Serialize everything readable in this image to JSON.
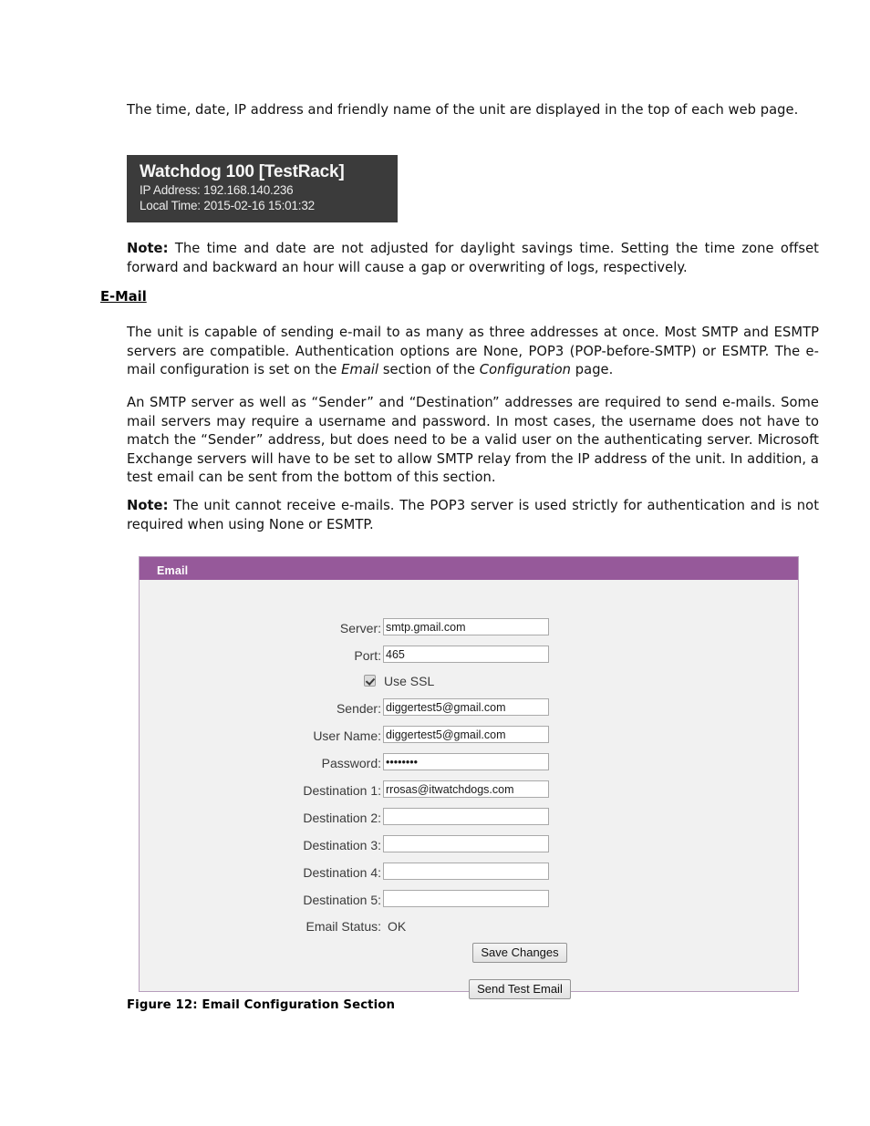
{
  "document": {
    "intro_paragraph": "The time, date, IP address and friendly name of the unit are displayed in the top of each web page.",
    "note_time": {
      "label": "Note:",
      "text": " The time and date are not adjusted for daylight savings time.  Setting the time zone offset forward and backward an hour will cause a gap or overwriting of logs, respectively."
    },
    "section_heading": "E-Mail",
    "paragraph_capability_part1": "The unit is capable of sending e-mail to as many as three addresses at once.  Most SMTP and ESMTP servers are compatible.  Authentication options are None, POP3 (POP-before-SMTP) or ESMTP. The e-mail configuration is set on the ",
    "paragraph_capability_em1": "Email",
    "paragraph_capability_part2": " section of the ",
    "paragraph_capability_em2": "Configuration",
    "paragraph_capability_part3": " page.",
    "paragraph_requirements": "An SMTP server as well as “Sender” and “Destination” addresses are required to send e-mails.  Some mail servers may require a username and password.  In most cases, the username does not have to match the “Sender” address, but does need to be a valid user on the authenticating server.  Microsoft Exchange servers will have to be set to allow SMTP relay from the IP address of the unit. In addition, a test email can be sent from the bottom of this section.",
    "note_receive": {
      "label": "Note:",
      "text": " The unit cannot receive e-mails.  The POP3 server is used strictly for authentication and is not required when using None or ESMTP."
    },
    "figure_caption": "Figure 12: Email Configuration Section"
  },
  "device_banner": {
    "title": "Watchdog 100 [TestRack]",
    "ip_line": "IP Address: 192.168.140.236",
    "time_line": "Local Time: 2015-02-16 15:01:32",
    "background_color": "#3b3b3b",
    "text_color": "#f2f2f2"
  },
  "email_panel": {
    "header_title": "Email",
    "header_color": "#96599a",
    "body_color": "#f1f1f1",
    "border_color": "#b79ebc",
    "fields": [
      {
        "label": "Server:",
        "value": "smtp.gmail.com",
        "placeholder": ""
      },
      {
        "label": "Port:",
        "value": "465",
        "placeholder": ""
      },
      {
        "label": "Sender:",
        "value": "diggertest5@gmail.com",
        "placeholder": ""
      },
      {
        "label": "User Name:",
        "value": "diggertest5@gmail.com",
        "placeholder": ""
      },
      {
        "label": "Password:",
        "value": "••••••••",
        "placeholder": ""
      },
      {
        "label": "Destination 1:",
        "value": "rrosas@itwatchdogs.com",
        "placeholder": ""
      },
      {
        "label": "Destination 2:",
        "value": "",
        "placeholder": ""
      },
      {
        "label": "Destination 3:",
        "value": "",
        "placeholder": ""
      },
      {
        "label": "Destination 4:",
        "value": "",
        "placeholder": ""
      },
      {
        "label": "Destination 5:",
        "value": "",
        "placeholder": ""
      }
    ],
    "use_ssl": {
      "label": "Use SSL",
      "checked": true
    },
    "status": {
      "label": "Email Status:",
      "value": "OK"
    },
    "buttons": {
      "save": "Save Changes",
      "send_test": "Send Test Email"
    }
  }
}
